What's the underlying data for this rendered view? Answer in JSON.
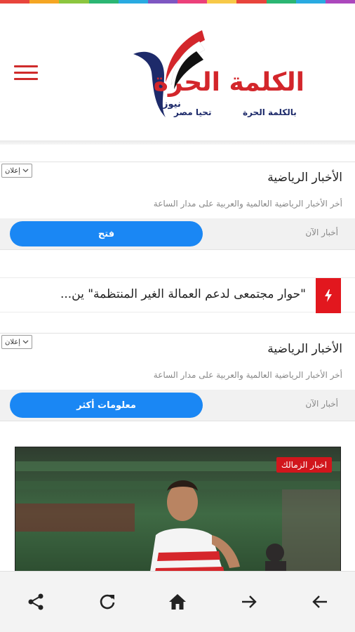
{
  "colors": {
    "strip": [
      "#e8453c",
      "#f5a623",
      "#8cc63f",
      "#2bb673",
      "#29aae1",
      "#7e57c2",
      "#ec407a",
      "#f7c948",
      "#e8453c",
      "#2bb673",
      "#29aae1",
      "#ab47bc"
    ],
    "brand_red": "#d3262b",
    "brand_navy": "#1d2a6a",
    "cta_blue": "#1a87f4",
    "badge_red": "#d1161c"
  },
  "header": {
    "menu_icon": "hamburger-menu-icon",
    "logo": {
      "title": "الكلمة الحرة",
      "news_word": "نيوز",
      "tagline_1": "بالكلمة الحرة",
      "tagline_2": "تحيا مصر"
    }
  },
  "ads": [
    {
      "label": "إعلان",
      "title": "الأخبار الرياضية",
      "description": "أخر الأخبار الرياضية العالمية والعربية على مدار الساعة",
      "source": "أخبار الآن",
      "cta": "فتح"
    },
    {
      "label": "إعلان",
      "title": "الأخبار الرياضية",
      "description": "أخر الأخبار الرياضية العالمية والعربية على مدار الساعة",
      "source": "أخبار الآن",
      "cta": "معلومات أكثر"
    }
  ],
  "breaking": {
    "icon": "lightning-bolt-icon",
    "text": "\"حوار مجتمعى لدعم العمالة الغير المنتظمة\" ين..."
  },
  "article_card": {
    "category": "اخبار الزمالك"
  },
  "bottom_nav": [
    {
      "name": "share-icon"
    },
    {
      "name": "refresh-icon"
    },
    {
      "name": "home-icon"
    },
    {
      "name": "forward-arrow-icon"
    },
    {
      "name": "back-arrow-icon"
    }
  ]
}
